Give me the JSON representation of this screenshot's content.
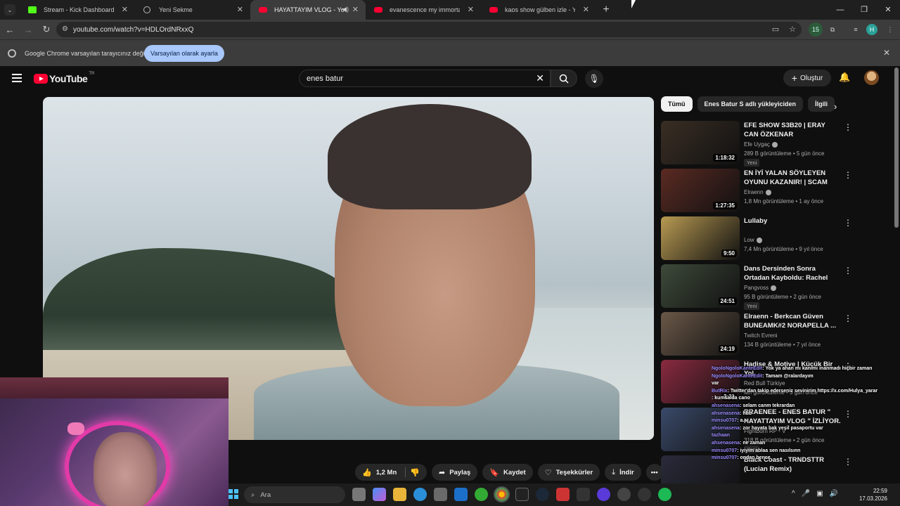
{
  "browser": {
    "tabs": [
      {
        "title": "Stream - Kick Dashboard",
        "favicon": "kick-icon",
        "active": false
      },
      {
        "title": "Yeni Sekme",
        "favicon": "globe-icon",
        "active": false
      },
      {
        "title": "HAYATTAYIM VLOG - YouTu",
        "favicon": "youtube-icon",
        "active": true
      },
      {
        "title": "evanescence my immortal - You",
        "favicon": "youtube-icon",
        "active": false
      },
      {
        "title": "kaos show gülben izle - YouTu",
        "favicon": "youtube-icon",
        "active": false
      }
    ],
    "url": "youtube.com/watch?v=HDLOrdNRxxQ",
    "profile_initial": "H",
    "ext_badge": "15"
  },
  "infobar": {
    "message": "Google Chrome varsayılan tarayıcınız değil",
    "button": "Varsayılan olarak ayarla"
  },
  "youtube": {
    "logo": "YouTube",
    "region": "TR",
    "search_value": "enes batur",
    "create_label": "Oluştur"
  },
  "actions": {
    "like_count": "1,2 Mn",
    "share": "Paylaş",
    "save": "Kaydet",
    "thanks": "Teşekkürler",
    "download": "İndir"
  },
  "chips": [
    "Tümü",
    "Enes Batur S adlı yükleyiciden",
    "İlgili"
  ],
  "recommendations": [
    {
      "title": "EFE SHOW S3B20 | ERAY CAN ÖZKENAR",
      "channel": "Efe Uygaç",
      "verified": true,
      "meta": "289 B görüntüleme • 5 gün önce",
      "badge": "Yeni",
      "duration": "1:18:32",
      "thumb_color": "#3a2e24"
    },
    {
      "title": "EN İYİ YALAN SÖYLEYEN OYUNU KAZANIR! | SCAM LIN...",
      "channel": "Elraenn",
      "verified": true,
      "meta": "1,8 Mn görüntüleme • 1 ay önce",
      "badge": "",
      "duration": "1:27:35",
      "thumb_color": "#5a2a22"
    },
    {
      "title": "Lullaby",
      "channel": "Low",
      "verified": true,
      "meta": "7,4 Mn görüntüleme • 9 yıl önce",
      "badge": "",
      "duration": "9:50",
      "thumb_color": "#b89a52"
    },
    {
      "title": "Dans Dersinden Sonra Ortadan Kayboldu: Rachel Barber'a Ne ...",
      "channel": "Pangvoss",
      "verified": true,
      "meta": "95 B görüntüleme • 2 gün önce",
      "badge": "Yeni",
      "duration": "24:51",
      "thumb_color": "#3e4a3a"
    },
    {
      "title": "Elraenn - Berkcan Güven BUNEAMK#2 NORAPELLA ...",
      "channel": "Twitch Evreni",
      "verified": false,
      "meta": "134 B görüntüleme • 7 yıl önce",
      "badge": "",
      "duration": "24:19",
      "thumb_color": "#6a5848"
    },
    {
      "title": "Hadise & Motive | Küçük Bir Yol",
      "channel": "Red Bull Türkiye",
      "verified": false,
      "meta": "Mn görüntüleme • 3 gün önce",
      "badge": "",
      "duration": "3:31",
      "thumb_color": "#8a2a40"
    },
    {
      "title": "RRAENEE - ENES BATUR \" HAYATTAYIM VLOG \" İZLİYOR.",
      "channel": "Fightborn RP - V",
      "verified": false,
      "meta": "318 B görüntüleme • 2 gün önce",
      "badge": "Yeni",
      "duration": "",
      "thumb_color": "#3a4a6a"
    },
    {
      "title": "Black Coast - TRNDSTTR (Lucian Remix)",
      "channel": "",
      "verified": false,
      "meta": "",
      "badge": "",
      "duration": "",
      "thumb_color": "#2a2a3a"
    }
  ],
  "chat": [
    {
      "user": "NgoloNgoloKanteEdit",
      "text": ": Yok ya ahan mı kanımı inanmadı hiçbir zaman"
    },
    {
      "user": "NgoloNgoloKanteEdit",
      "text": ": Tamam @ralardayım"
    },
    {
      "user": "",
      "text": "var"
    },
    {
      "user": "ButRix",
      "text": ": Twitter'dan takip ederseniz sevinirim https://x.com/Hulya_yarar"
    },
    {
      "user": "",
      "text": ": kumsalda cano"
    },
    {
      "user": "ahsenasena",
      "text": ": selam canm tekrardan"
    },
    {
      "user": "",
      "text": ""
    },
    {
      "user": "ahsenasena",
      "text": ": hbb"
    },
    {
      "user": "minsu0707",
      "text": ": a.a"
    },
    {
      "user": "",
      "text": ""
    },
    {
      "user": "ahsenasena",
      "text": ": zor hayata bak yeşil pasaportu var"
    },
    {
      "user": "tazhaan",
      "text": ""
    },
    {
      "user": "ahsenasena",
      "text": ": ne zaman"
    },
    {
      "user": "minsu0707",
      "text": ": iyiyim ablaa sen nasılsınn"
    },
    {
      "user": "minsu0707",
      "text": ": ondan bence"
    }
  ],
  "taskbar": {
    "search_placeholder": "Ara",
    "time": "22:59",
    "date": "17.03.2026"
  }
}
